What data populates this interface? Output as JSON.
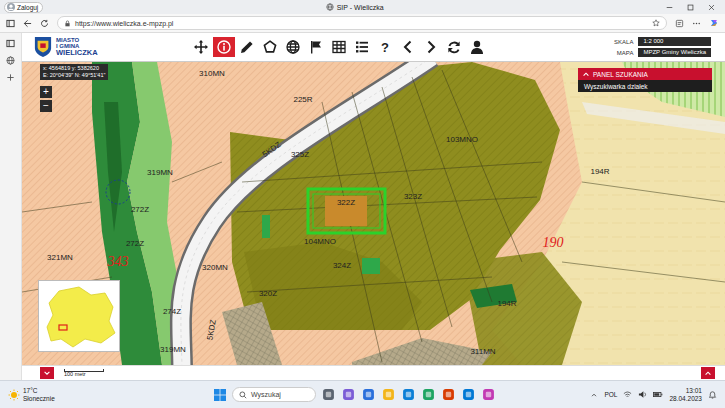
{
  "browser": {
    "profile": "Zaloguj",
    "tab_title": "SIP - Wieliczka",
    "url": "https://www.wieliczka.e-mpzp.pl"
  },
  "header": {
    "logo": [
      "MIASTO",
      "I GMINA",
      "WIELICZKA"
    ],
    "tools": [
      {
        "selected": false
      },
      {
        "selected": true
      },
      {
        "selected": false
      },
      {
        "selected": false
      },
      {
        "selected": false
      },
      {
        "selected": false
      },
      {
        "selected": false
      },
      {
        "selected": false
      },
      {
        "glyph": "?",
        "selected": false
      },
      {
        "selected": false
      },
      {
        "selected": false
      },
      {
        "selected": false
      },
      {
        "selected": false
      }
    ],
    "scale": {
      "label": "SKALA",
      "value": "1:2 000"
    },
    "map": {
      "label": "MAPA",
      "value": "MPZP Gminy Wieliczka"
    }
  },
  "map": {
    "coords": [
      "x: 4564819 y: 5382620",
      "E: 20°04'39\" N: 49°51'41\""
    ],
    "zoom": [
      "+",
      "−"
    ],
    "search_panel": {
      "title": "PANEL SZUKANIA",
      "item": "Wyszukiwarka działek",
      "expanded": true
    },
    "labels": [
      {
        "text": "310MN",
        "color": "#222222"
      },
      {
        "text": "225R",
        "color": "#222222"
      },
      {
        "text": "103MNO",
        "color": "#222222"
      },
      {
        "text": "319MN",
        "color": "#222222"
      },
      {
        "text": "325Z",
        "color": "#222222"
      },
      {
        "text": "322Z",
        "color": "#222222"
      },
      {
        "text": "323Z",
        "color": "#222222"
      },
      {
        "text": "194R",
        "color": "#222222"
      },
      {
        "text": "190",
        "color": "#e0201a"
      },
      {
        "text": "104MNO",
        "color": "#222222"
      },
      {
        "text": "320MN",
        "color": "#222222"
      },
      {
        "text": "321MN",
        "color": "#222222"
      },
      {
        "text": "343",
        "color": "#e0201a"
      },
      {
        "text": "324Z",
        "color": "#222222"
      },
      {
        "text": "320Z",
        "color": "#222222"
      },
      {
        "text": "272Z",
        "color": "#222222"
      },
      {
        "text": "272Z",
        "color": "#222222"
      },
      {
        "text": "274Z",
        "color": "#222222"
      },
      {
        "text": "319MN",
        "color": "#222222"
      },
      {
        "text": "311MN",
        "color": "#222222"
      },
      {
        "text": "194R",
        "color": "#222222"
      },
      {
        "text": "5KDZ",
        "color": "#222222"
      },
      {
        "text": "5KDZ",
        "color": "#222222"
      }
    ]
  },
  "bottom": {
    "scale_bar": "100 metr"
  },
  "taskbar": {
    "temperature": "17°C",
    "weather": "Słonecznie",
    "search_placeholder": "Wyszukaj",
    "language": "POL",
    "time": "13:01",
    "date": "28.04.2023"
  }
}
